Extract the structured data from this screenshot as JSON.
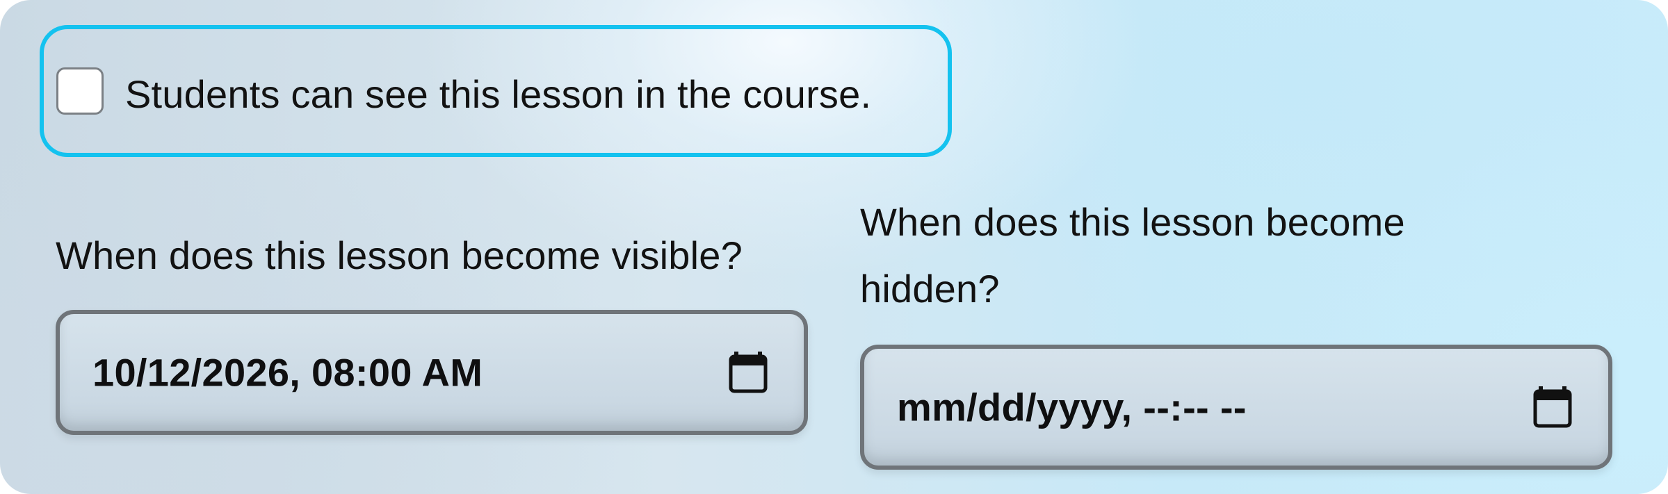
{
  "visibility_checkbox": {
    "checked": false,
    "label": "Students can see this lesson in the course."
  },
  "visible_from": {
    "label": "When does this lesson become visible?",
    "value": "10/12/2026, 08:00 AM",
    "icon": "calendar-icon"
  },
  "hidden_from": {
    "label": "When does this lesson become hidden?",
    "value": "",
    "placeholder": "mm/dd/yyyy, --:-- --",
    "icon": "calendar-icon"
  },
  "colors": {
    "focus_ring": "#14c2ef",
    "input_border": "#6f7479",
    "text": "#121212"
  }
}
